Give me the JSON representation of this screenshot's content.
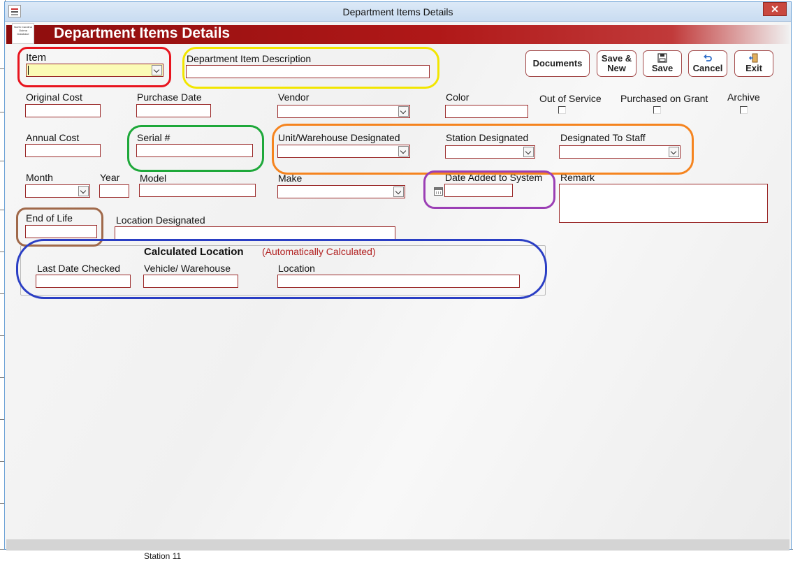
{
  "window": {
    "title": "Department Items Details",
    "close_glyph": "✕"
  },
  "header": {
    "title": "Department Items Details",
    "logo_text": "North Carolina Ouirna Database"
  },
  "toolbar": {
    "documents": "Documents",
    "save_new_line1": "Save &",
    "save_new_line2": "New",
    "save": "Save",
    "cancel": "Cancel",
    "exit": "Exit"
  },
  "fields": {
    "item": "Item",
    "description": "Department Item Description",
    "original_cost": "Original Cost",
    "purchase_date": "Purchase Date",
    "vendor": "Vendor",
    "color": "Color",
    "out_of_service": "Out of Service",
    "purchased_on_grant": "Purchased on Grant",
    "archive": "Archive",
    "annual_cost": "Annual  Cost",
    "serial": "Serial #",
    "unit_warehouse": "Unit/Warehouse Designated",
    "station_designated": "Station Designated",
    "designated_to_staff": "Designated To Staff",
    "month": "Month",
    "year": "Year",
    "model": "Model",
    "make": "Make",
    "date_added": "Date Added to System",
    "remark": "Remark",
    "end_of_life": "End of Life",
    "location_designated": "Location Designated"
  },
  "calculated": {
    "title": "Calculated  Location",
    "note": "(Automatically Calculated)",
    "last_date_checked": "Last Date Checked",
    "vehicle_warehouse": "Vehicle/ Warehouse",
    "location": "Location"
  },
  "background": {
    "bottom_cell": "Station 11"
  },
  "highlight_colors": {
    "item": "#e8141e",
    "description": "#f2e600",
    "serial": "#1ea83a",
    "designation": "#f5841f",
    "date_added": "#9b3fb5",
    "end_of_life": "#a0694a",
    "calculated": "#2a3ec4"
  }
}
